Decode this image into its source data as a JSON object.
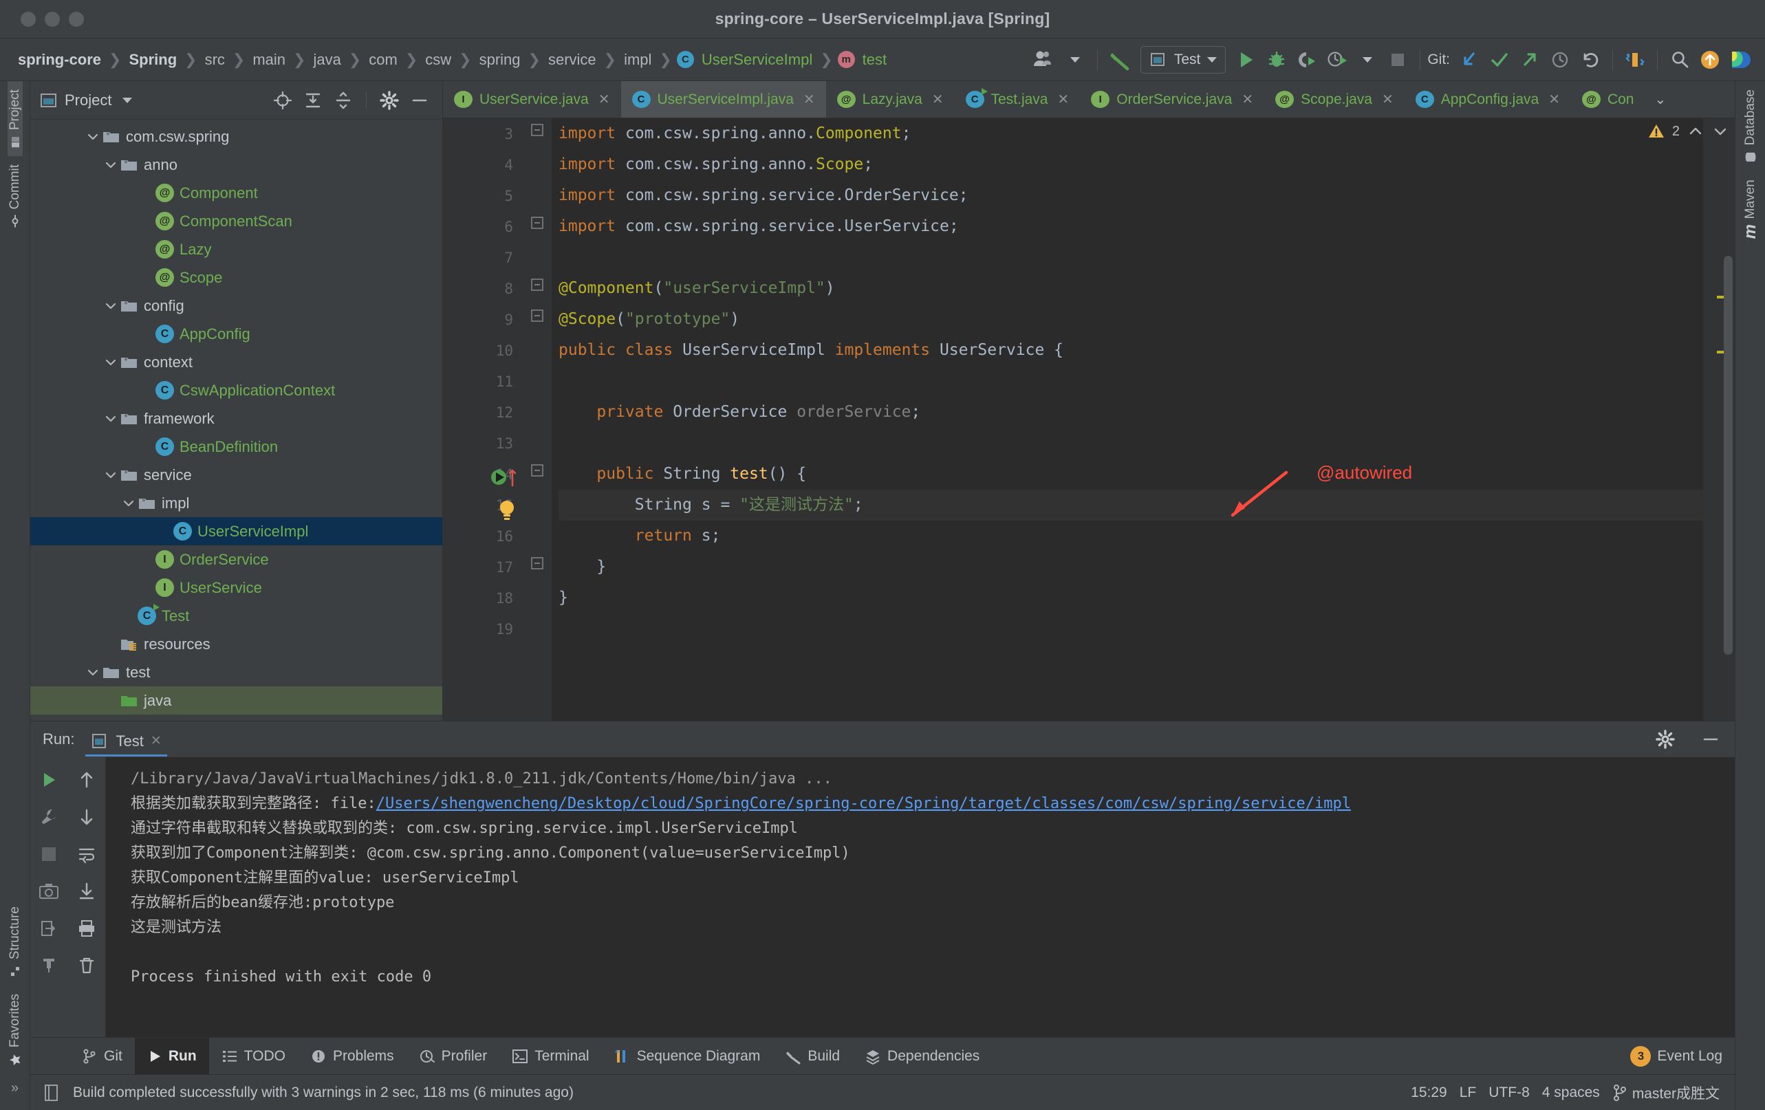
{
  "window": {
    "title": "spring-core – UserServiceImpl.java [Spring]"
  },
  "breadcrumbs": [
    {
      "label": "spring-core",
      "style": "bold"
    },
    {
      "label": "Spring",
      "style": "bold"
    },
    {
      "label": "src",
      "style": "normal"
    },
    {
      "label": "main",
      "style": "normal"
    },
    {
      "label": "java",
      "style": "normal"
    },
    {
      "label": "com",
      "style": "normal"
    },
    {
      "label": "csw",
      "style": "normal"
    },
    {
      "label": "spring",
      "style": "normal"
    },
    {
      "label": "service",
      "style": "normal"
    },
    {
      "label": "impl",
      "style": "normal"
    },
    {
      "label": "UserServiceImpl",
      "style": "class",
      "icon": "class-icon"
    },
    {
      "label": "test",
      "style": "method",
      "icon": "method-icon"
    }
  ],
  "toolbar": {
    "run_config": "Test",
    "git_label": "Git:",
    "icons": [
      "user-avatar-icon",
      "build-hammer-icon",
      "run-icon",
      "debug-icon",
      "run-with-coverage-icon",
      "profile-icon",
      "stop-icon",
      "git-update-icon",
      "git-commit-icon",
      "git-push-icon",
      "git-history-icon",
      "git-rollback-icon",
      "layout-icon",
      "search-icon",
      "update-icon",
      "ide-icon"
    ]
  },
  "left_strip": {
    "top": [
      {
        "label": "Project",
        "active": true,
        "icon": "project-icon"
      },
      {
        "label": "Commit",
        "active": false,
        "icon": "commit-icon"
      }
    ],
    "bottom": [
      {
        "label": "Structure",
        "active": false,
        "icon": "structure-icon"
      },
      {
        "label": "Favorites",
        "active": false,
        "icon": "star-icon"
      }
    ],
    "more": "»"
  },
  "right_strip": {
    "items": [
      {
        "label": "Database",
        "icon": "database-icon"
      },
      {
        "label": "Maven",
        "icon": "maven-icon"
      }
    ]
  },
  "project_panel": {
    "title": "Project",
    "header_icons": [
      "locate-icon",
      "expand-all-icon",
      "collapse-all-icon",
      "gear-icon",
      "minimize-icon"
    ],
    "tree": [
      {
        "label": "com.csw.spring",
        "indent": 3,
        "kind": "package",
        "twisty": "down",
        "color": "white"
      },
      {
        "label": "anno",
        "indent": 4,
        "kind": "package",
        "twisty": "down",
        "color": "white"
      },
      {
        "label": "Component",
        "indent": 6,
        "kind": "annotation",
        "twisty": "none",
        "color": "green"
      },
      {
        "label": "ComponentScan",
        "indent": 6,
        "kind": "annotation",
        "twisty": "none",
        "color": "green"
      },
      {
        "label": "Lazy",
        "indent": 6,
        "kind": "annotation",
        "twisty": "none",
        "color": "green"
      },
      {
        "label": "Scope",
        "indent": 6,
        "kind": "annotation",
        "twisty": "none",
        "color": "green"
      },
      {
        "label": "config",
        "indent": 4,
        "kind": "package",
        "twisty": "down",
        "color": "white"
      },
      {
        "label": "AppConfig",
        "indent": 6,
        "kind": "class",
        "twisty": "none",
        "color": "green"
      },
      {
        "label": "context",
        "indent": 4,
        "kind": "package",
        "twisty": "down",
        "color": "white"
      },
      {
        "label": "CswApplicationContext",
        "indent": 6,
        "kind": "class",
        "twisty": "none",
        "color": "green"
      },
      {
        "label": "framework",
        "indent": 4,
        "kind": "package",
        "twisty": "down",
        "color": "white"
      },
      {
        "label": "BeanDefinition",
        "indent": 6,
        "kind": "class",
        "twisty": "none",
        "color": "green"
      },
      {
        "label": "service",
        "indent": 4,
        "kind": "package",
        "twisty": "down",
        "color": "white"
      },
      {
        "label": "impl",
        "indent": 5,
        "kind": "package",
        "twisty": "down",
        "color": "white"
      },
      {
        "label": "UserServiceImpl",
        "indent": 7,
        "kind": "class",
        "twisty": "none",
        "color": "green",
        "selected": "blue"
      },
      {
        "label": "OrderService",
        "indent": 6,
        "kind": "interface",
        "twisty": "none",
        "color": "green"
      },
      {
        "label": "UserService",
        "indent": 6,
        "kind": "interface",
        "twisty": "none",
        "color": "green"
      },
      {
        "label": "Test",
        "indent": 5,
        "kind": "runnable-class",
        "twisty": "none",
        "color": "green"
      },
      {
        "label": "resources",
        "indent": 4,
        "kind": "resources-folder",
        "twisty": "none",
        "color": "white"
      },
      {
        "label": "test",
        "indent": 3,
        "kind": "folder",
        "twisty": "down",
        "color": "white"
      },
      {
        "label": "java",
        "indent": 4,
        "kind": "source-folder",
        "twisty": "none",
        "color": "white",
        "selected": "green"
      }
    ]
  },
  "editor_tabs": [
    {
      "label": "UserService.java",
      "kind": "interface",
      "active": false
    },
    {
      "label": "UserServiceImpl.java",
      "kind": "class",
      "active": true
    },
    {
      "label": "Lazy.java",
      "kind": "annotation",
      "active": false
    },
    {
      "label": "Test.java",
      "kind": "runnable-class",
      "active": false
    },
    {
      "label": "OrderService.java",
      "kind": "interface",
      "active": false
    },
    {
      "label": "Scope.java",
      "kind": "annotation",
      "active": false
    },
    {
      "label": "AppConfig.java",
      "kind": "class",
      "active": false
    },
    {
      "label": "Con",
      "kind": "annotation",
      "active": false
    }
  ],
  "editor": {
    "warning_count": "2",
    "warning_icon": "warning-triangle-icon",
    "first_line_number": 3,
    "line_numbers": [
      3,
      4,
      5,
      6,
      7,
      8,
      9,
      10,
      11,
      12,
      13,
      14,
      15,
      16,
      17,
      18,
      19
    ],
    "lines": [
      "import com.csw.spring.anno.Component;",
      "import com.csw.spring.anno.Scope;",
      "import com.csw.spring.service.OrderService;",
      "import com.csw.spring.service.UserService;",
      "",
      "@Component(\"userServiceImpl\")",
      "@Scope(\"prototype\")",
      "public class UserServiceImpl implements UserService {",
      "",
      "    private OrderService orderService;",
      "",
      "    public String test() {",
      "        String s = \"这是测试方法\";",
      "        return s;",
      "    }",
      "}",
      ""
    ],
    "annotation": {
      "text": "@autowired",
      "color": "#ff4a3d"
    }
  },
  "run_panel": {
    "label": "Run:",
    "tab": "Test",
    "side_icons": [
      "rerun-icon",
      "scroll-up-icon",
      "wrench-icon",
      "scroll-down-icon",
      "stop-icon",
      "soft-wrap-icon",
      "camera-icon",
      "scroll-to-end-icon",
      "print-icon",
      "clear-all-icon",
      "export-icon",
      "pin-icon"
    ],
    "console": [
      {
        "text": "/Library/Java/JavaVirtualMachines/jdk1.8.0_211.jdk/Contents/Home/bin/java ...",
        "type": "dim"
      },
      {
        "text": "根据类加载获取到完整路径: file:",
        "type": "normal",
        "link": "/Users/shengwencheng/Desktop/cloud/SpringCore/spring-core/Spring/target/classes/com/csw/spring/service/impl"
      },
      {
        "text": "通过字符串截取和转义替换或取到的类: com.csw.spring.service.impl.UserServiceImpl",
        "type": "normal"
      },
      {
        "text": "获取到加了Component注解到类: @com.csw.spring.anno.Component(value=userServiceImpl)",
        "type": "normal"
      },
      {
        "text": "获取Component注解里面的value: userServiceImpl",
        "type": "normal"
      },
      {
        "text": "存放解析后的bean缓存池:prototype",
        "type": "normal"
      },
      {
        "text": "这是测试方法",
        "type": "normal"
      },
      {
        "text": "",
        "type": "normal"
      },
      {
        "text": "Process finished with exit code 0",
        "type": "normal"
      }
    ]
  },
  "bottom_toolbar": {
    "items": [
      {
        "label": "Git",
        "icon": "git-branch-icon",
        "active": false
      },
      {
        "label": "Run",
        "icon": "run-icon",
        "active": true
      },
      {
        "label": "TODO",
        "icon": "todo-icon",
        "active": false
      },
      {
        "label": "Problems",
        "icon": "problems-icon",
        "active": false
      },
      {
        "label": "Profiler",
        "icon": "profiler-icon",
        "active": false
      },
      {
        "label": "Terminal",
        "icon": "terminal-icon",
        "active": false
      },
      {
        "label": "Sequence Diagram",
        "icon": "sequence-diagram-icon",
        "active": false
      },
      {
        "label": "Build",
        "icon": "build-icon",
        "active": false
      },
      {
        "label": "Dependencies",
        "icon": "dependencies-icon",
        "active": false
      }
    ],
    "event_log": {
      "label": "Event Log",
      "count": "3"
    }
  },
  "status_bar": {
    "message": "Build completed successfully with 3 warnings in 2 sec, 118 ms (6 minutes ago)",
    "time": "15:29",
    "line_sep": "LF",
    "encoding": "UTF-8",
    "indent": "4 spaces",
    "branch": "master成胜文"
  }
}
